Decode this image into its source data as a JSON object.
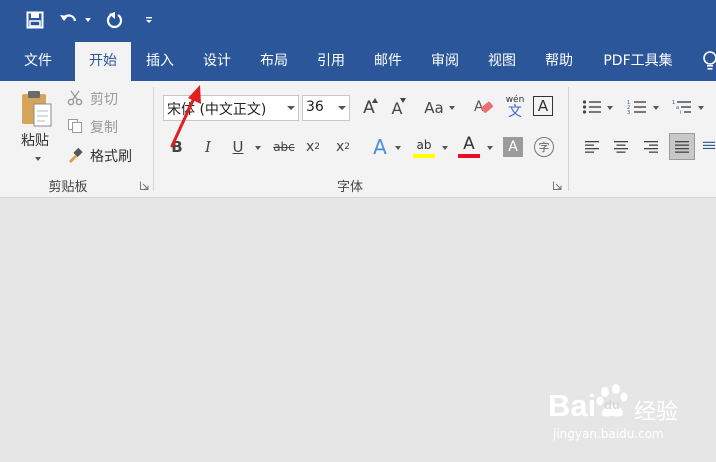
{
  "colors": {
    "accent": "#2b579a",
    "ribbon_bg": "#f3f3f3",
    "canvas_bg": "#e6e6e6",
    "font_color_red": "#e81123",
    "highlight_yellow": "#ffff00",
    "arrow_red": "#e02020"
  },
  "quick_access": {
    "icons": [
      "save-icon",
      "undo-icon",
      "redo-icon",
      "customize-qat-icon"
    ]
  },
  "tabs": [
    {
      "label": "文件",
      "active": false
    },
    {
      "label": "开始",
      "active": true
    },
    {
      "label": "插入",
      "active": false
    },
    {
      "label": "设计",
      "active": false
    },
    {
      "label": "布局",
      "active": false
    },
    {
      "label": "引用",
      "active": false
    },
    {
      "label": "邮件",
      "active": false
    },
    {
      "label": "审阅",
      "active": false
    },
    {
      "label": "视图",
      "active": false
    },
    {
      "label": "帮助",
      "active": false
    },
    {
      "label": "PDF工具集",
      "active": false
    }
  ],
  "clipboard": {
    "paste_label": "粘贴",
    "cut_label": "剪切",
    "copy_label": "复制",
    "format_painter_label": "格式刷",
    "group_label": "剪贴板"
  },
  "font": {
    "font_name": "宋体 (中文正文)",
    "font_size": "36",
    "group_label": "字体",
    "grow_glyph": "A",
    "shrink_glyph": "A",
    "case_glyph": "Aa",
    "phonetic_top": "wén",
    "phonetic_bottom": "文",
    "border_glyph": "A",
    "bold": "B",
    "italic": "I",
    "underline": "U",
    "strike": "abc",
    "sub_base": "x",
    "sub_mark": "2",
    "sup_base": "x",
    "sup_mark": "2",
    "effects_glyph": "A",
    "highlight_glyph": "ab",
    "font_color_glyph": "A",
    "shading_glyph": "A",
    "enclose_glyph": "字"
  },
  "watermark": {
    "brand_a": "Bai",
    "brand_b": "du",
    "brand_cn": "经验",
    "url": "jingyan.baidu.com"
  }
}
